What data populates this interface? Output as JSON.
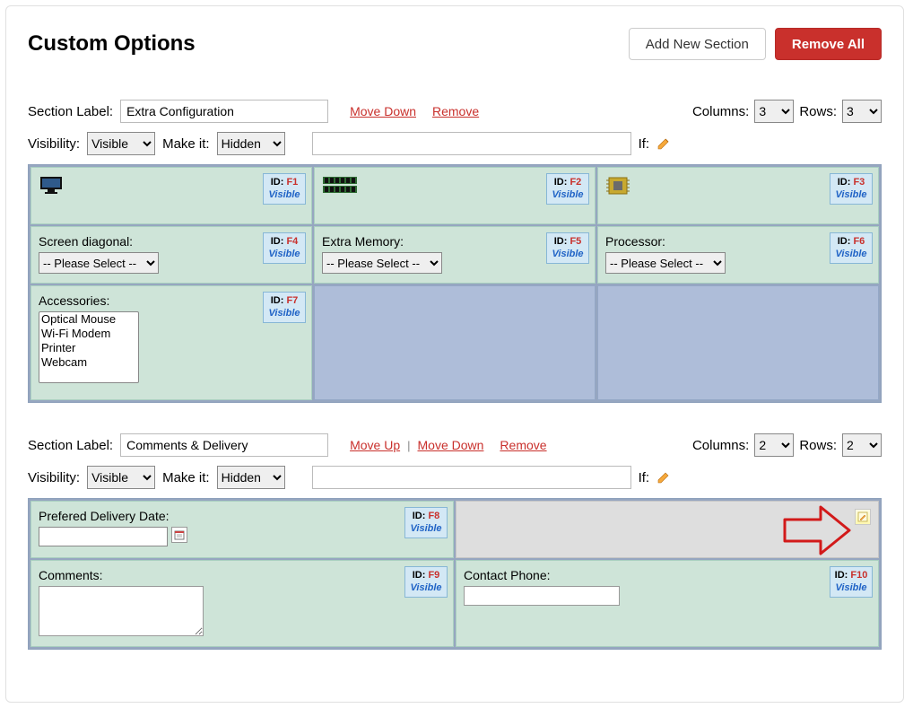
{
  "header": {
    "title": "Custom Options",
    "add_button": "Add New Section",
    "remove_button": "Remove All"
  },
  "labels": {
    "section_label": "Section Label:",
    "columns": "Columns:",
    "rows": "Rows:",
    "visibility": "Visibility:",
    "make_it": "Make it:",
    "if": "If:",
    "move_up": "Move Up",
    "move_down": "Move Down",
    "remove": "Remove",
    "sep": "|",
    "please_select": "-- Please Select --",
    "id_prefix": "ID:",
    "visible_word": "Visible"
  },
  "visibility_options": [
    "Visible",
    "Hidden"
  ],
  "makeit_options": [
    "Hidden",
    "Visible"
  ],
  "section1": {
    "name": "Extra Configuration",
    "columns": "3",
    "rows": "3",
    "visibility": "Visible",
    "make_it": "Hidden",
    "if_value": "",
    "has_move_up": false,
    "fields": {
      "f1": {
        "id": "F1",
        "state": "Visible"
      },
      "f2": {
        "id": "F2",
        "state": "Visible"
      },
      "f3": {
        "id": "F3",
        "state": "Visible"
      },
      "f4": {
        "id": "F4",
        "state": "Visible",
        "label": "Screen diagonal:"
      },
      "f5": {
        "id": "F5",
        "state": "Visible",
        "label": "Extra Memory:"
      },
      "f6": {
        "id": "F6",
        "state": "Visible",
        "label": "Processor:"
      },
      "f7": {
        "id": "F7",
        "state": "Visible",
        "label": "Accessories:",
        "options": [
          "Optical Mouse",
          "Wi-Fi Modem",
          "Printer",
          "Webcam"
        ]
      }
    }
  },
  "section2": {
    "name": "Comments & Delivery",
    "columns": "2",
    "rows": "2",
    "visibility": "Visible",
    "make_it": "Hidden",
    "if_value": "",
    "has_move_up": true,
    "fields": {
      "f8": {
        "id": "F8",
        "state": "Visible",
        "label": "Prefered Delivery Date:"
      },
      "f9": {
        "id": "F9",
        "state": "Visible",
        "label": "Comments:"
      },
      "f10": {
        "id": "F10",
        "state": "Visible",
        "label": "Contact Phone:"
      }
    }
  }
}
